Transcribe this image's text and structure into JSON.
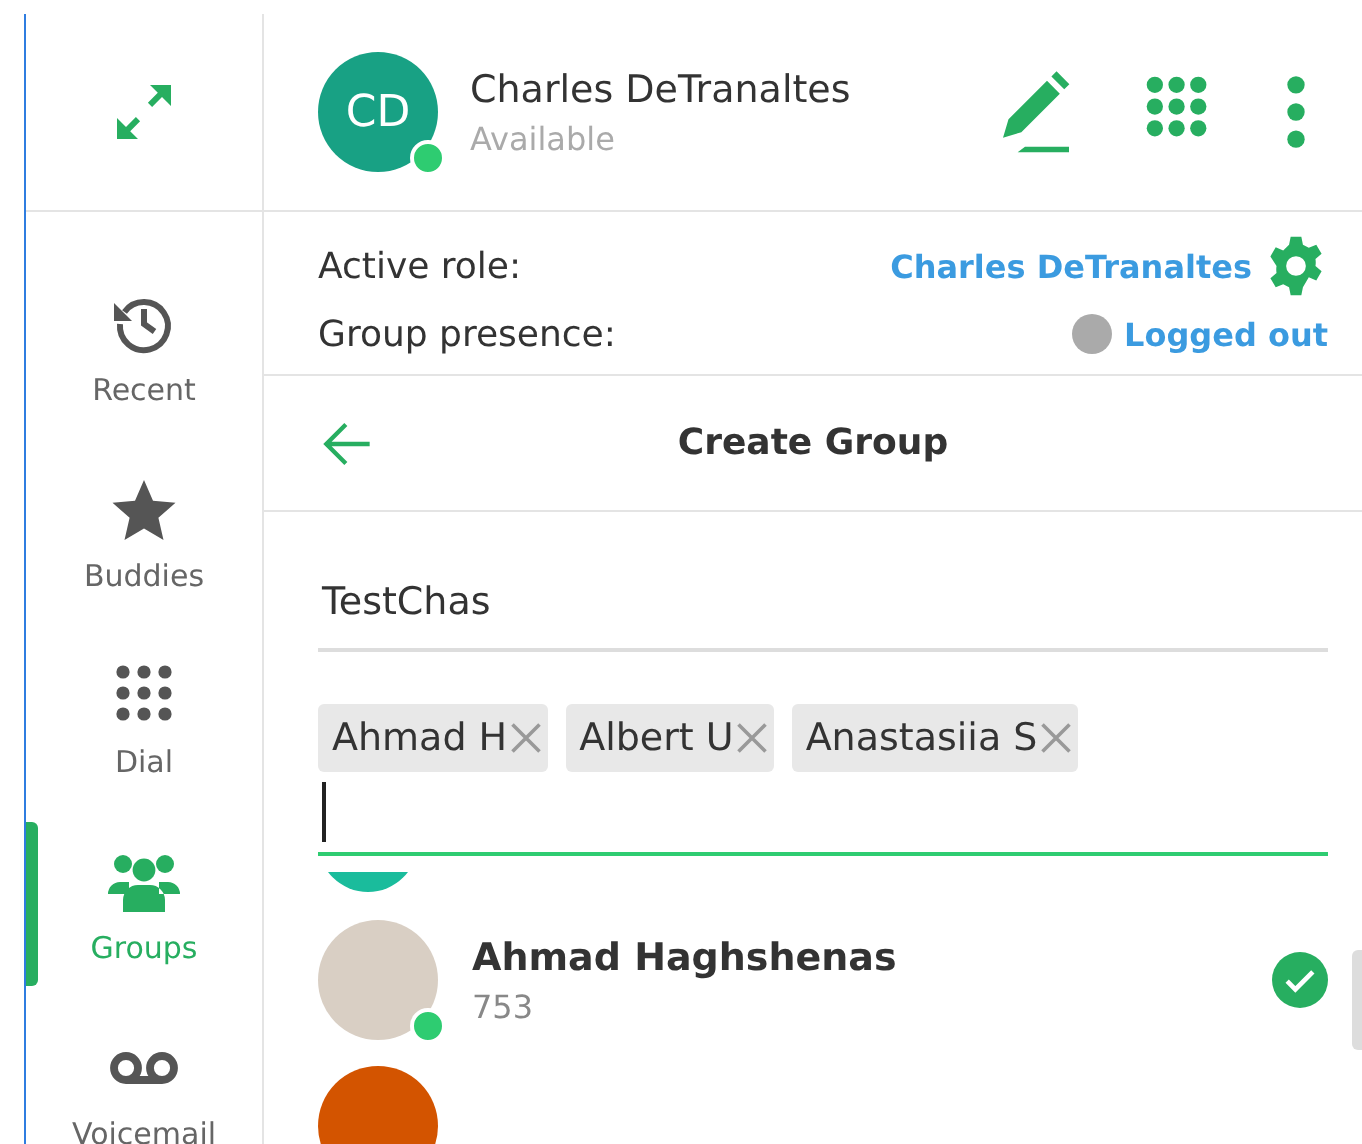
{
  "sidebar": {
    "items": [
      {
        "label": "Recent",
        "selected": false
      },
      {
        "label": "Buddies",
        "selected": false
      },
      {
        "label": "Dial",
        "selected": false
      },
      {
        "label": "Groups",
        "selected": true
      },
      {
        "label": "Voicemail",
        "selected": false
      }
    ]
  },
  "header": {
    "initials": "CD",
    "name": "Charles DeTranaltes",
    "status": "Available"
  },
  "roles": {
    "active_role_label": "Active role:",
    "active_role": "Charles DeTranaltes",
    "group_presence_label": "Group presence:",
    "group_presence": "Logged out"
  },
  "create_group": {
    "title": "Create Group",
    "group_name": "TestChas",
    "members": [
      "Ahmad H",
      "Albert U",
      "Anastasiia S"
    ],
    "contacts": [
      {
        "name": "Ahmad Haghshenas",
        "extension": "753",
        "selected": true
      }
    ]
  }
}
